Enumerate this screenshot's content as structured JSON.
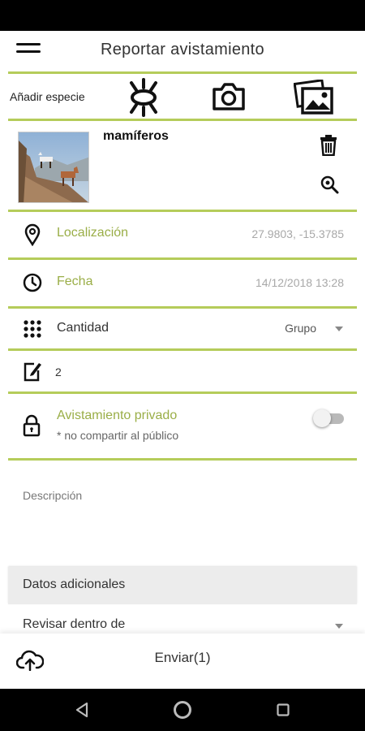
{
  "header": {
    "title": "Reportar avistamiento",
    "menu_icon": "hamburger-menu-icon"
  },
  "add_species": {
    "label": "Añadir especie",
    "buttons": [
      {
        "icon": "species-bug-icon"
      },
      {
        "icon": "camera-icon"
      },
      {
        "icon": "gallery-icon"
      }
    ]
  },
  "species": {
    "name": "mamíferos",
    "photo_subject": "goats-on-rocks-photo",
    "delete_icon": "trash-icon",
    "search_icon": "search-icon"
  },
  "location": {
    "label": "Localización",
    "value": "27.9803, -15.3785",
    "icon": "location-pin-icon"
  },
  "date": {
    "label": "Fecha",
    "value": "14/12/2018 13:28",
    "icon": "clock-icon"
  },
  "quantity": {
    "label": "Cantidad",
    "selected": "Grupo",
    "icon": "dots-grid-icon"
  },
  "count": {
    "value": "2",
    "icon": "edit-note-icon"
  },
  "private": {
    "label": "Avistamiento privado",
    "note": "* no compartir al público",
    "enabled": false,
    "icon": "lock-icon"
  },
  "description": {
    "placeholder": "Descripción"
  },
  "extra": {
    "label": "Datos adicionales"
  },
  "review": {
    "label": "Revisar dentro de"
  },
  "footer": {
    "send_label": "Enviar(1)",
    "upload_icon": "cloud-upload-icon"
  },
  "colors": {
    "accent": "#b5cc5a",
    "accent_text": "#9aae47",
    "muted": "#a8a8a8"
  },
  "system_nav": {
    "back_icon": "back-triangle-icon",
    "home_icon": "home-circle-icon",
    "recents_icon": "recents-square-icon"
  }
}
